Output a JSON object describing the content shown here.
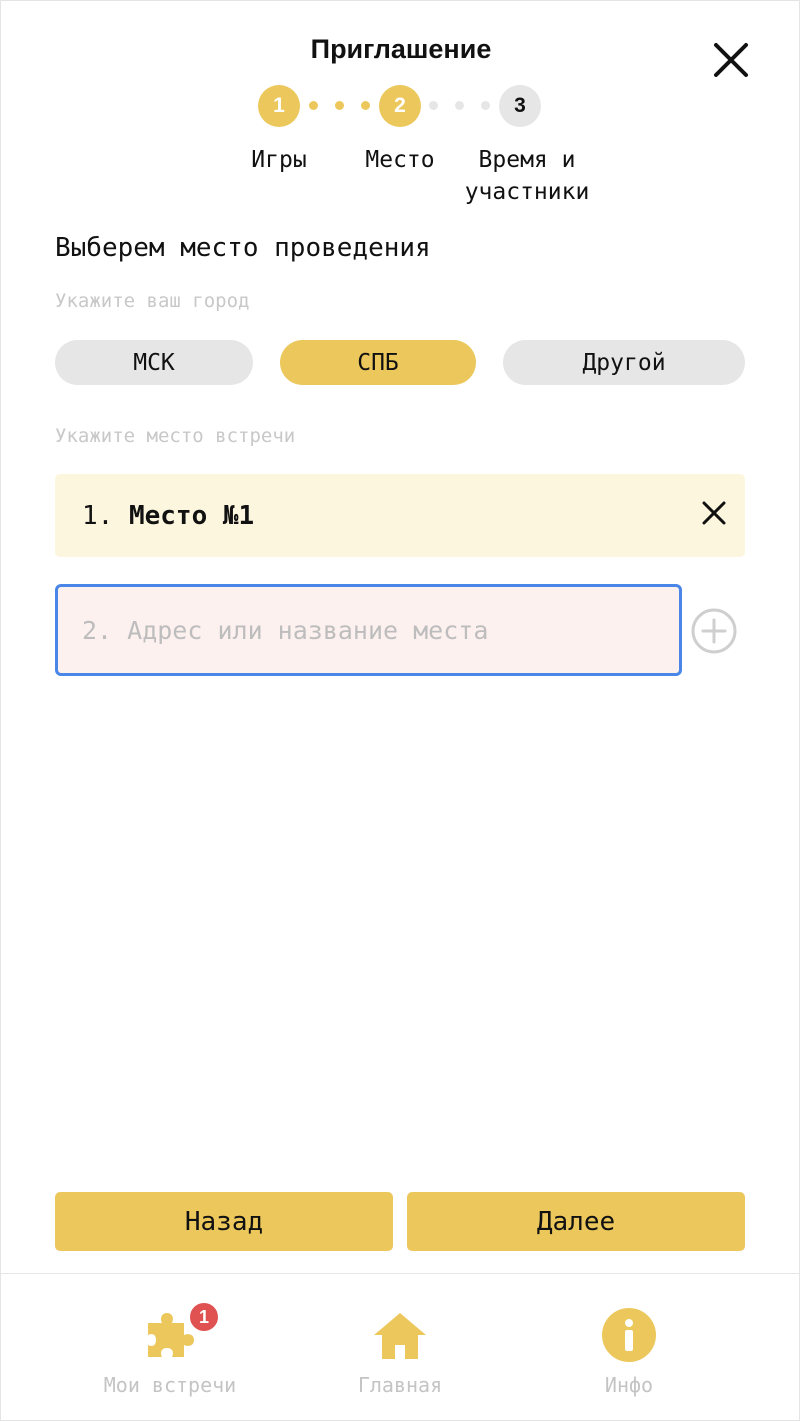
{
  "header": {
    "title": "Приглашение"
  },
  "stepper": {
    "steps": [
      {
        "number": "1",
        "label": "Игры",
        "state": "done"
      },
      {
        "number": "2",
        "label": "Место",
        "state": "done"
      },
      {
        "number": "3",
        "label_line1": "Время и",
        "label_line2": "участники",
        "state": "todo"
      }
    ]
  },
  "section": {
    "heading": "Выберем место проведения",
    "city_hint": "Укажите ваш город",
    "place_hint": "Укажите место встречи"
  },
  "cities": {
    "options": [
      "МСК",
      "СПБ",
      "Другой"
    ],
    "selected": "СПБ"
  },
  "places": {
    "items": [
      {
        "number": "1.",
        "name": "Место №1"
      }
    ],
    "new_input": {
      "value": "",
      "placeholder": "2. Адрес или название места"
    }
  },
  "actions": {
    "back_label": "Назад",
    "next_label": "Далее"
  },
  "tabbar": {
    "items": [
      {
        "label": "Мои встречи",
        "icon": "puzzle-icon",
        "badge": "1"
      },
      {
        "label": "Главная",
        "icon": "home-icon"
      },
      {
        "label": "Инфо",
        "icon": "info-icon"
      }
    ]
  },
  "colors": {
    "accent": "#ECC85C",
    "inactive": "#E6E6E6",
    "card_bg": "#FDF6DE",
    "input_bg": "#FDF1F0",
    "input_focus": "#4A86E8",
    "badge": "#E05252"
  }
}
